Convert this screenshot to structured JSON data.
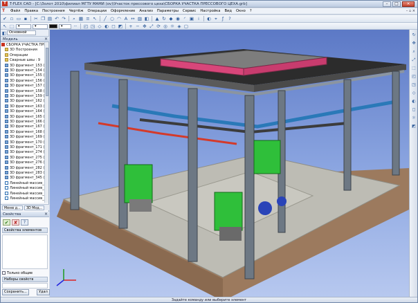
{
  "window": {
    "title": "T-FLEX CAD - [C:\\Золот 2010\\филиал МГТУ МАМИ (ov)\\Участок прессового цеха\\СБОРКА УЧАСТКА ПРЕССОВОГО ЦЕХА.grb]",
    "logo": "T",
    "minimize": "–",
    "maximize": "□",
    "close": "×"
  },
  "menu": {
    "items": [
      "Файл",
      "Правка",
      "Построения",
      "Чертёж",
      "Операции",
      "Оформление",
      "Анализ",
      "Параметры",
      "Сервис",
      "Настройка",
      "Вид",
      "Окно",
      "?"
    ],
    "right": "– ▫ ×"
  },
  "view_selector": {
    "value": "Основной"
  },
  "model_panel": {
    "title": "Модель",
    "tree": [
      {
        "label": "СБОРКА УЧАСТКА ПРЕССОВО",
        "icon": "root"
      },
      {
        "label": "3D Построения",
        "icon": "folder"
      },
      {
        "label": "Операции",
        "icon": "folder"
      },
      {
        "label": "Сварные швы : 9",
        "icon": "folder"
      },
      {
        "label": "3D фрагмент_153 (С:\\Оо",
        "icon": "frag"
      },
      {
        "label": "3D фрагмент_154 (С:\\Оо",
        "icon": "frag"
      },
      {
        "label": "3D фрагмент_155 (С:\\Оо",
        "icon": "frag"
      },
      {
        "label": "3D фрагмент_156 (С:\\Оо",
        "icon": "frag"
      },
      {
        "label": "3D фрагмент_157 (С:\\Оо",
        "icon": "frag"
      },
      {
        "label": "3D фрагмент_158 (С:\\Оо",
        "icon": "frag"
      },
      {
        "label": "3D фрагмент_159 (С:\\Оо",
        "icon": "frag"
      },
      {
        "label": "3D фрагмент_162 (С:\\Оо",
        "icon": "frag"
      },
      {
        "label": "3D фрагмент_163 (С:\\Оо",
        "icon": "frag"
      },
      {
        "label": "3D фрагмент_164 (С:\\Оо",
        "icon": "frag"
      },
      {
        "label": "3D фрагмент_165 (С:\\Оо",
        "icon": "frag"
      },
      {
        "label": "3D фрагмент_166 (С:\\Оо",
        "icon": "frag"
      },
      {
        "label": "3D фрагмент_167 (С:\\Оо",
        "icon": "frag"
      },
      {
        "label": "3D фрагмент_168 (С:\\Оо",
        "icon": "frag"
      },
      {
        "label": "3D фрагмент_169 (С:\\Оо",
        "icon": "frag"
      },
      {
        "label": "3D фрагмент_170 (С:\\Оо",
        "icon": "frag"
      },
      {
        "label": "3D фрагмент_171 (С:\\Оо",
        "icon": "frag"
      },
      {
        "label": "3D фрагмент_274 (Котел",
        "icon": "frag"
      },
      {
        "label": "3D фрагмент_275 (С:\\Оо",
        "icon": "frag"
      },
      {
        "label": "3D фрагмент_276 (Котел",
        "icon": "frag"
      },
      {
        "label": "3D фрагмент_282 (С:\\Оо",
        "icon": "frag"
      },
      {
        "label": "3D фрагмент_283 (С:\\Оо",
        "icon": "frag"
      },
      {
        "label": "3D фрагмент_345 (С:\\Оо",
        "icon": "frag"
      },
      {
        "label": "Линейный массив_126",
        "icon": "line"
      },
      {
        "label": "Линейный массив_127",
        "icon": "line"
      },
      {
        "label": "Линейный массив_128",
        "icon": "line"
      },
      {
        "label": "Линейный массив_129",
        "icon": "line"
      }
    ]
  },
  "panel_tabs": [
    {
      "label": "Меню д..."
    },
    {
      "label": "3D Мод..."
    }
  ],
  "properties_panel": {
    "title": "Свойства",
    "ok": "✔",
    "cancel": "✘",
    "help": "?",
    "element_props": "Свойства элементов",
    "only_common": "Только общие",
    "property_sets": "Наборы свойств",
    "save_button": "Сохранить...",
    "delete_button": "Удал"
  },
  "status": {
    "text": "Задайте команду или выберите элемент"
  },
  "colors": {
    "sky_top": "#5c79c6",
    "roof": "#2c2c2c",
    "truss": "#8b95a0",
    "press": "#2fbf3a",
    "floor": "#bdbcb4",
    "soil": "#9c7a5e"
  }
}
